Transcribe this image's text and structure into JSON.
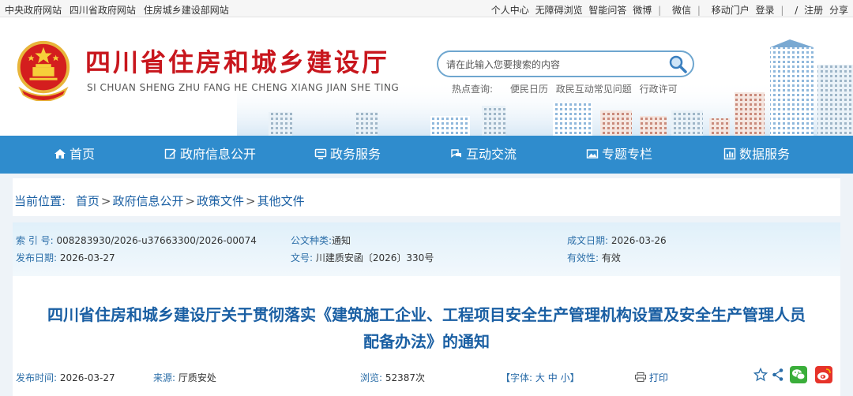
{
  "topbar": {
    "links_left": [
      "中央政府网站",
      "四川省政府网站",
      "住房城乡建设部网站"
    ],
    "links_right_a": [
      "个人中心",
      "无障碍浏览",
      "智能问答",
      "微博"
    ],
    "wechat": "微信",
    "mobile": "移动门户",
    "login": "登录",
    "slash": "/",
    "register": "注册",
    "share": "分享"
  },
  "header": {
    "title": "四川省住房和城乡建设厅",
    "pinyin": "SI CHUAN SHENG ZHU FANG HE CHENG XIANG JIAN SHE TING",
    "search_placeholder": "请在此输入您要搜索的内容",
    "hot_label": "热点查询:",
    "hot_links": [
      "便民日历",
      "政民互动常见问题",
      "行政许可"
    ]
  },
  "nav": {
    "items": [
      {
        "label": "首页",
        "icon": "home-icon"
      },
      {
        "label": "政府信息公开",
        "icon": "edit-icon"
      },
      {
        "label": "政务服务",
        "icon": "monitor-icon"
      },
      {
        "label": "互动交流",
        "icon": "chat-icon"
      },
      {
        "label": "专题专栏",
        "icon": "image-icon"
      },
      {
        "label": "数据服务",
        "icon": "chart-icon"
      }
    ]
  },
  "breadcrumb": {
    "label": "当前位置:",
    "items": [
      "首页",
      "政府信息公开",
      "政策文件",
      "其他文件"
    ],
    "separator": ">"
  },
  "meta": {
    "index_key": "索 引 号:",
    "index_val": "008283930/2026-u37663300/2026-00074",
    "type_key": "公文种类:",
    "type_val": "通知",
    "made_key": "成文日期:",
    "made_val": "2026-03-26",
    "pub_key": "发布日期:",
    "pub_val": "2026-03-27",
    "num_key": "文号:",
    "num_val": "川建质安函〔2026〕330号",
    "valid_key": "有效性:",
    "valid_val": "有效"
  },
  "document": {
    "title_line1": "四川省住房和城乡建设厅关于贯彻落实《建筑施工企业、工程项目安全生产管理机构设置及安全生产管理人员",
    "title_line2": "配备办法》的通知"
  },
  "info": {
    "time_key": "发布时间:",
    "time_val": "2026-03-27",
    "source_key": "来源:",
    "source_val": "厅质安处",
    "views_key": "浏览:",
    "views_val": "52387次",
    "font_open": "【字体:",
    "font_large": "大",
    "font_medium": "中",
    "font_small": "小",
    "font_close": "】",
    "print": "打印"
  },
  "colors": {
    "nav_blue": "#2f8ccd",
    "title_red": "#c8161d",
    "link_blue": "#1a5fa3"
  }
}
